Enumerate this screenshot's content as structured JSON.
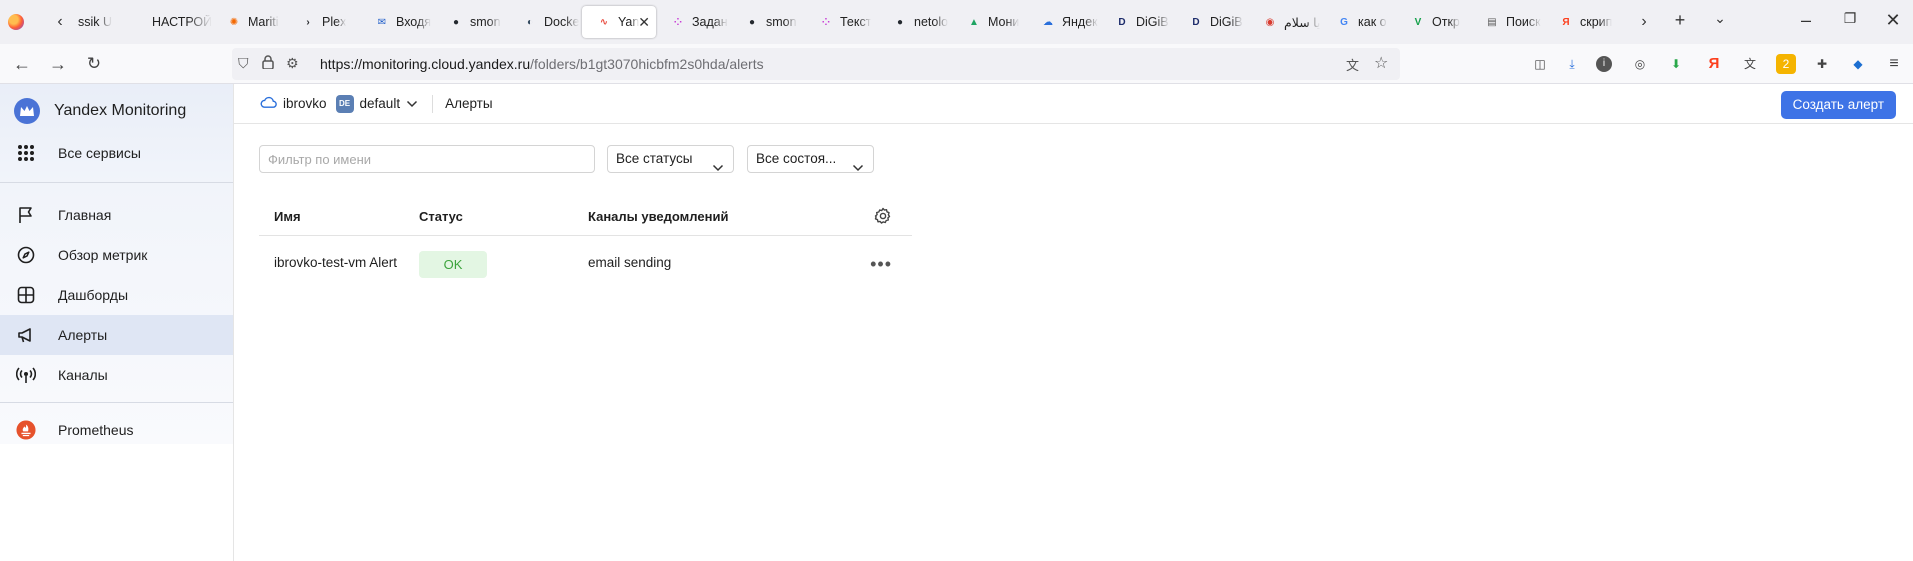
{
  "browser": {
    "tabs": [
      {
        "label": "ssik U",
        "icon": "page-icon",
        "color": "#9aa0a6"
      },
      {
        "label": "НАСТРОЙ",
        "icon": "page-icon",
        "color": "#9aa0a6"
      },
      {
        "label": "Mariti",
        "icon": "grafana-icon",
        "color": "#f46800"
      },
      {
        "label": "Plex",
        "icon": "plex-icon",
        "color": "#282a2d"
      },
      {
        "label": "Входя",
        "icon": "mail-icon",
        "color": "#1f5ec9"
      },
      {
        "label": "smon",
        "icon": "github-icon",
        "color": "#24292f"
      },
      {
        "label": "Docke",
        "icon": "docker-icon",
        "color": "#334a5e"
      },
      {
        "label": "Yan",
        "icon": "yandex-monitoring-icon",
        "color": "#e8493d"
      },
      {
        "label": "Задан",
        "icon": "dots-icon",
        "color": "#c83fd6"
      },
      {
        "label": "smon",
        "icon": "github-icon",
        "color": "#24292f"
      },
      {
        "label": "Текст",
        "icon": "dots-icon",
        "color": "#c83fd6"
      },
      {
        "label": "netolo",
        "icon": "github-icon",
        "color": "#24292f"
      },
      {
        "label": "Мони",
        "icon": "drive-icon",
        "color": "#1fa463"
      },
      {
        "label": "Яндек",
        "icon": "cloud-icon",
        "color": "#2a6fdb"
      },
      {
        "label": "DiGiB",
        "icon": "digib-icon",
        "color": "#1d2c6b"
      },
      {
        "label": "DiGiB",
        "icon": "digib-icon",
        "color": "#1d2c6b"
      },
      {
        "label": "يا سلام",
        "icon": "circle-icon",
        "color": "#d83b2f"
      },
      {
        "label": "как о",
        "icon": "google-icon",
        "color": "#4285f4"
      },
      {
        "label": "Откр",
        "icon": "check-icon",
        "color": "#14a04a"
      },
      {
        "label": "Поиск",
        "icon": "search-page-icon",
        "color": "#555555"
      },
      {
        "label": "скрип",
        "icon": "yandex-icon",
        "color": "#fc3f1d"
      }
    ],
    "active_tab_index": 7,
    "url_host": "https://monitoring.cloud.yandex.ru",
    "url_path": "/folders/b1gt3070hicbfm2s0hda/alerts"
  },
  "app": {
    "brand": "Yandex Monitoring",
    "all_services": "Все сервисы",
    "nav": [
      {
        "label": "Главная",
        "icon": "flag-icon"
      },
      {
        "label": "Обзор метрик",
        "icon": "compass-icon"
      },
      {
        "label": "Дашборды",
        "icon": "dashboard-icon"
      },
      {
        "label": "Алерты",
        "icon": "megaphone-icon"
      },
      {
        "label": "Каналы",
        "icon": "broadcast-icon"
      }
    ],
    "active_nav_index": 3,
    "extra": {
      "label": "Prometheus",
      "icon": "prometheus-icon"
    }
  },
  "breadcrumb": {
    "cloud": "ibrovko",
    "folder_badge": "DE",
    "folder": "default",
    "page": "Алерты"
  },
  "create_button": "Создать алерт",
  "filters": {
    "name_placeholder": "Фильтр по имени",
    "status_select": "Все статусы",
    "state_select": "Все состоя..."
  },
  "table": {
    "columns": [
      "Имя",
      "Статус",
      "Каналы уведомлений"
    ],
    "rows": [
      {
        "name": "ibrovko-test-vm Alert",
        "status": "OK",
        "channels": "email sending"
      }
    ]
  },
  "colors": {
    "accent": "#3e73e6",
    "ok_bg": "#e3f6e3",
    "ok_text": "#3ca33c"
  }
}
